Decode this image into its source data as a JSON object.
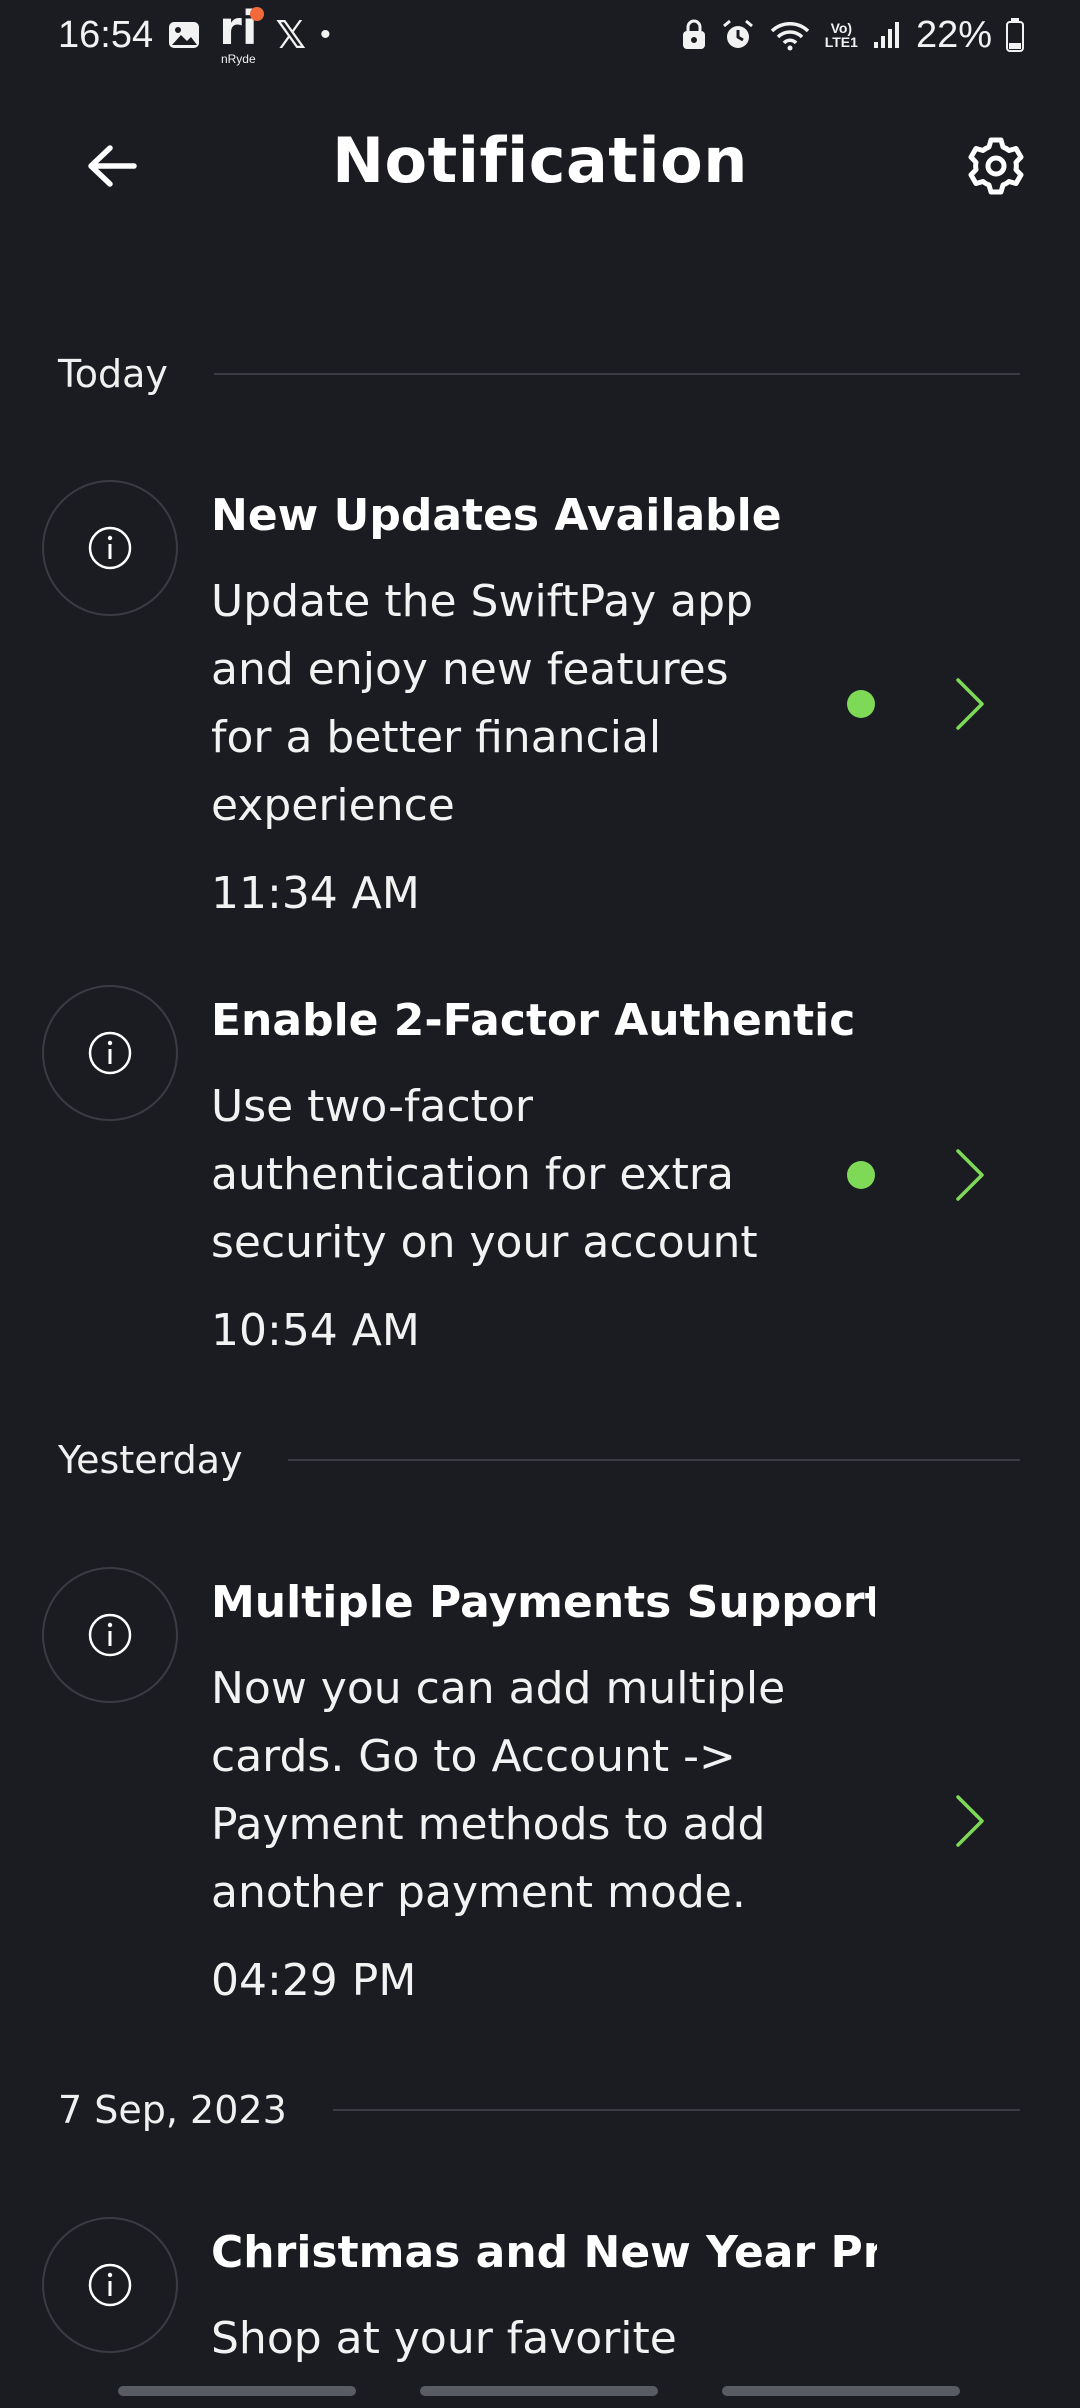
{
  "status_bar": {
    "time": "16:54",
    "app_label": "nRyde",
    "app_glyph": "ri",
    "x_glyph": "𝕏",
    "dot": "•",
    "network": {
      "top": "Vo)",
      "bottom": "LTE1"
    },
    "battery": "22%",
    "icons": [
      "gallery-icon",
      "nryde-app-icon",
      "x-app-icon",
      "notification-dot",
      "lock-icon",
      "alarm-icon",
      "wifi-icon",
      "volte-icon",
      "signal-icon",
      "battery-icon"
    ]
  },
  "header": {
    "title": "Notification",
    "back_icon": "arrow-left-icon",
    "settings_icon": "gear-icon"
  },
  "sections": [
    {
      "label": "Today",
      "items": [
        {
          "title": "New Updates Available",
          "body": [
            "Update the SwiftPay app",
            "and enjoy new features",
            "for a better financial",
            "experience"
          ],
          "time": "11:34 AM",
          "unread": true
        },
        {
          "title": "Enable 2-Factor Authentic",
          "body": [
            "Use two-factor",
            "authentication for extra",
            "security on your account"
          ],
          "time": "10:54 AM",
          "unread": true
        }
      ]
    },
    {
      "label": "Yesterday",
      "items": [
        {
          "title": "Multiple Payments Support U",
          "body": [
            "Now you can add multiple",
            "cards. Go to Account ->",
            "Payment methods to add",
            "another payment mode."
          ],
          "time": "04:29 PM",
          "unread": false
        }
      ]
    },
    {
      "label": "7 Sep, 2023",
      "items": [
        {
          "title": "Christmas and New Year Pro",
          "body": [
            "Shop at your favorite"
          ],
          "time": "",
          "unread": false
        }
      ]
    }
  ],
  "colors": {
    "background": "#1b1c21",
    "accent": "#7ed957",
    "divider": "#3b3d44",
    "icon_ring": "#3a3c43"
  }
}
